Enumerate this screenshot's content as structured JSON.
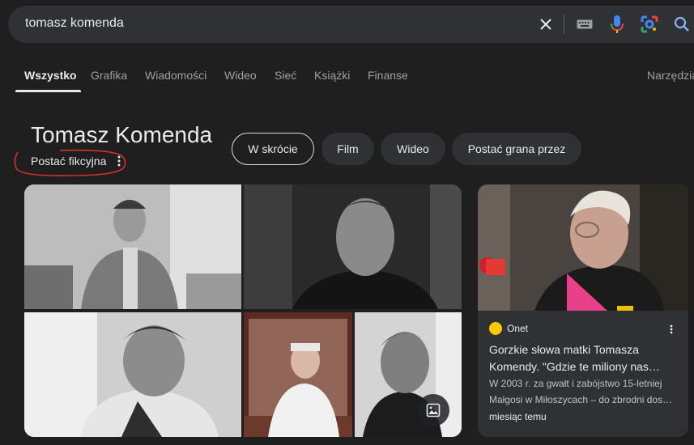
{
  "search": {
    "query": "tomasz komenda"
  },
  "tabs": [
    {
      "label": "Wszystko",
      "active": true
    },
    {
      "label": "Grafika"
    },
    {
      "label": "Wiadomości"
    },
    {
      "label": "Wideo"
    },
    {
      "label": "Sieć"
    },
    {
      "label": "Książki"
    },
    {
      "label": "Finanse"
    },
    {
      "label": "Narzędzia"
    }
  ],
  "entity": {
    "title": "Tomasz Komenda",
    "subtitle": "Postać fikcyjna",
    "chips": [
      {
        "label": "W skrócie",
        "selected": true
      },
      {
        "label": "Film"
      },
      {
        "label": "Wideo"
      },
      {
        "label": "Postać grana przez"
      }
    ]
  },
  "news": {
    "source": "Onet",
    "headline_line1": "Gorzkie słowa matki Tomasza",
    "headline_line2": "Komendy. \"Gdzie te miliony nas…",
    "snippet_line1": "W 2003 r. za gwałt i zabójstwo 15-letniej",
    "snippet_line2": "Małgosi w Miłoszycach – do zbrodni dos…",
    "time": "miesiąc temu"
  },
  "colors": {
    "background": "#1f1f1f",
    "surface": "#303134",
    "annotation_red": "#d93025",
    "source_logo": "#f9c900"
  },
  "icons": [
    "clear-icon",
    "keyboard-icon",
    "mic-icon",
    "lens-icon",
    "search-icon",
    "more-vert-icon",
    "image-icon"
  ]
}
